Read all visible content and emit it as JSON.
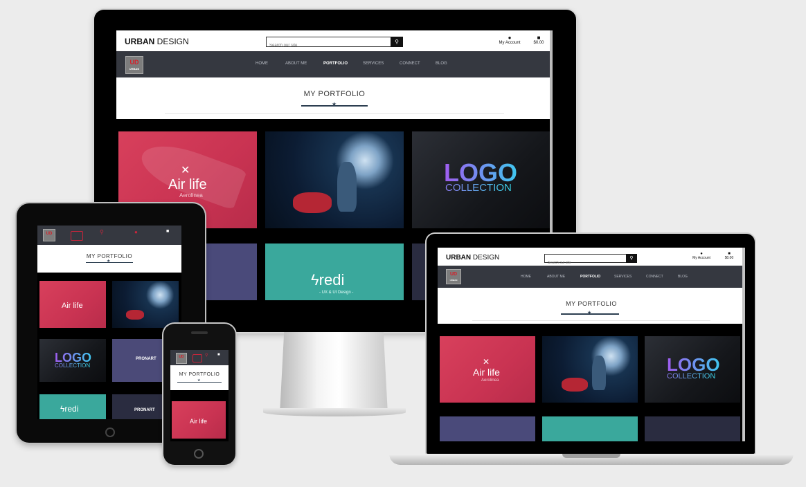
{
  "site": {
    "brand_bold": "URBAN",
    "brand_light": " DESIGN",
    "search_placeholder": "Search our site",
    "account_label": "My Account",
    "cart_label": "$0.00",
    "logo_text": "UD",
    "logo_sub": "URBAN"
  },
  "nav": {
    "items": [
      {
        "label": "HOME",
        "active": false
      },
      {
        "label": "ABOUT ME",
        "active": false
      },
      {
        "label": "PORTFOLIO",
        "active": true
      },
      {
        "label": "SERVICES",
        "active": false
      },
      {
        "label": "CONNECT",
        "active": false
      },
      {
        "label": "BLOG",
        "active": false
      }
    ]
  },
  "page": {
    "title": "MY PORTFOLIO"
  },
  "tiles": {
    "airlife_title": "Air life",
    "airlife_sub": "Aerolinea",
    "logo_line1": "LOGO",
    "logo_line2": "COLLECTION",
    "redi_title": "redi",
    "redi_sub": "- UX & UI Design -",
    "pronart_title": "PRONART"
  },
  "icons": {
    "search": "magnifier-icon",
    "account": "person-icon",
    "cart": "bag-icon"
  },
  "colors": {
    "nav_bg": "#353840",
    "accent": "#2c3e50",
    "airlife": "#d23a57",
    "redi": "#3aa89c"
  }
}
